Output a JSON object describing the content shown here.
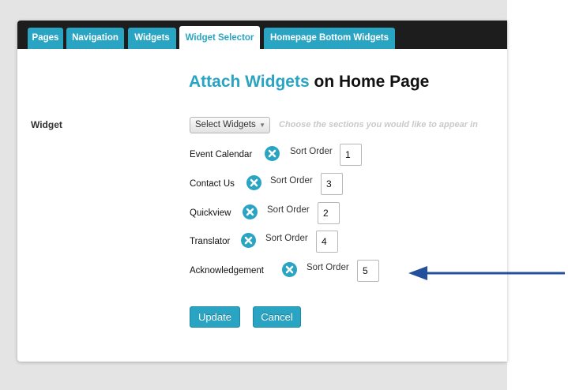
{
  "colors": {
    "accent": "#2aa4c3",
    "tabbar": "#1d1d1d",
    "arrow": "#24509b"
  },
  "tabs": [
    {
      "label": "Pages"
    },
    {
      "label": "Navigation"
    },
    {
      "label": "Widgets"
    },
    {
      "label": "Widget Selector",
      "active": true
    },
    {
      "label": "Homepage Bottom Widgets"
    }
  ],
  "heading": {
    "accent": "Attach Widgets",
    "rest": " on Home Page"
  },
  "form": {
    "field_label": "Widget",
    "select_value": "Select Widgets",
    "hint": "Choose the sections you would like to appear in"
  },
  "widgets": [
    {
      "name": "Event Calendar",
      "sort_label": "Sort Order",
      "sort_value": "1"
    },
    {
      "name": "Contact Us",
      "sort_label": "Sort Order",
      "sort_value": "3"
    },
    {
      "name": "Quickview",
      "sort_label": "Sort Order",
      "sort_value": "2"
    },
    {
      "name": "Translator",
      "sort_label": "Sort Order",
      "sort_value": "4"
    },
    {
      "name": "Acknowledgement",
      "sort_label": "Sort Order",
      "sort_value": "5"
    }
  ],
  "buttons": {
    "update": "Update",
    "cancel": "Cancel"
  }
}
